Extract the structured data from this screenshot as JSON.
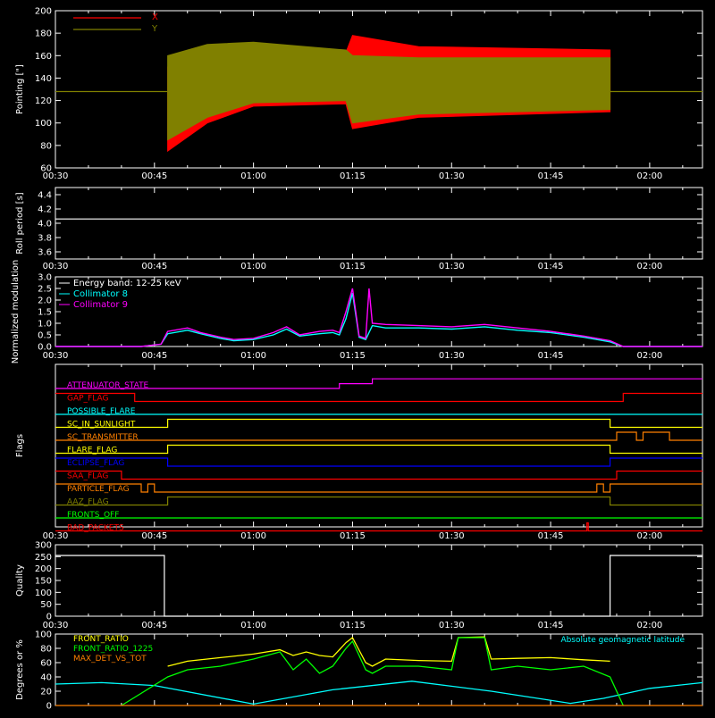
{
  "colors": {
    "background": "#000000",
    "axes": "#ffffff",
    "x_pointing": "#ff0000",
    "y_pointing": "#808000",
    "cyan": "#00ffff",
    "magenta": "#ff00ff",
    "yellow": "#ffff00",
    "green": "#00ff00",
    "orange": "#ff8000",
    "blue": "#0000ff",
    "red": "#ff0000"
  },
  "shared_x_ticks": [
    "00:30",
    "00:45",
    "01:00",
    "01:15",
    "01:30",
    "01:45",
    "02:00"
  ],
  "chart_data": [
    {
      "type": "line",
      "panel": "pointing",
      "ylabel": "Pointing [\"]",
      "ylim": [
        60,
        200
      ],
      "yticks": [
        60,
        80,
        100,
        120,
        140,
        160,
        180,
        200
      ],
      "xlim_minutes": [
        30,
        128
      ],
      "legend": {
        "placement": "top-left",
        "entries": [
          "X",
          "Y"
        ]
      },
      "series": [
        {
          "name": "X",
          "color": "#ff0000",
          "segments": [
            {
              "x": [
                47,
                53,
                60,
                74,
                75,
                85,
                114
              ],
              "upper": [
                150,
                168,
                170,
                163,
                178,
                168,
                165
              ],
              "lower": [
                75,
                100,
                115,
                117,
                95,
                105,
                110
              ]
            }
          ]
        },
        {
          "name": "Y",
          "color": "#808000",
          "flat_value": 128,
          "segments": [
            {
              "x": [
                47,
                53,
                60,
                74,
                75,
                85,
                114
              ],
              "upper": [
                160,
                170,
                172,
                165,
                160,
                158,
                158
              ],
              "lower": [
                85,
                105,
                118,
                120,
                100,
                108,
                112
              ]
            }
          ]
        }
      ]
    },
    {
      "type": "line",
      "panel": "roll_period",
      "ylabel": "Roll period [s]",
      "ylim": [
        3.5,
        4.5
      ],
      "yticks": [
        3.6,
        3.8,
        4.0,
        4.2,
        4.4
      ],
      "series": [
        {
          "color": "#ffffff",
          "x": [
            30,
            128
          ],
          "y": [
            4.06,
            4.06
          ]
        }
      ]
    },
    {
      "type": "line",
      "panel": "modulation",
      "ylabel": "Normalized modulation",
      "ylim": [
        0,
        3.0
      ],
      "yticks": [
        0.0,
        0.5,
        1.0,
        1.5,
        2.0,
        2.5,
        3.0
      ],
      "legend_title": "Energy band: 12-25 keV",
      "series": [
        {
          "name": "Collimator 8",
          "color": "#00ffff",
          "x": [
            30,
            43,
            46,
            47,
            50,
            52,
            55,
            57,
            60,
            63,
            65,
            67,
            70,
            72,
            73,
            74,
            75,
            76,
            77,
            78,
            80,
            85,
            90,
            95,
            100,
            105,
            110,
            114,
            116,
            128
          ],
          "y": [
            0,
            0,
            0.1,
            0.55,
            0.7,
            0.55,
            0.35,
            0.25,
            0.3,
            0.5,
            0.75,
            0.45,
            0.55,
            0.6,
            0.5,
            1.2,
            2.3,
            0.4,
            0.3,
            0.9,
            0.8,
            0.8,
            0.75,
            0.85,
            0.7,
            0.6,
            0.4,
            0.2,
            0,
            0
          ]
        },
        {
          "name": "Collimator 9",
          "color": "#ff00ff",
          "x": [
            30,
            43,
            46,
            47,
            50,
            52,
            55,
            57,
            60,
            63,
            65,
            67,
            70,
            72,
            73,
            74,
            75,
            76,
            77,
            77.5,
            78,
            80,
            85,
            90,
            95,
            100,
            105,
            110,
            114,
            116,
            128
          ],
          "y": [
            0,
            0,
            0.1,
            0.65,
            0.8,
            0.6,
            0.4,
            0.3,
            0.35,
            0.6,
            0.85,
            0.5,
            0.65,
            0.7,
            0.6,
            1.5,
            2.5,
            0.45,
            0.35,
            2.5,
            1.0,
            0.95,
            0.9,
            0.85,
            0.95,
            0.8,
            0.65,
            0.45,
            0.25,
            0,
            0
          ]
        }
      ]
    },
    {
      "type": "line",
      "panel": "flags",
      "ylabel": "Flags",
      "series": [
        {
          "name": "ATTENUATOR_STATE",
          "color": "#ff00ff",
          "x": [
            30,
            73,
            73,
            78,
            78,
            128
          ],
          "y": [
            0,
            0,
            1,
            1,
            2,
            2
          ]
        },
        {
          "name": "GAP_FLAG",
          "color": "#ff0000",
          "x": [
            30,
            42,
            42,
            116,
            116,
            128
          ],
          "y": [
            1,
            1,
            0,
            0,
            1,
            1
          ]
        },
        {
          "name": "POSSIBLE_FLARE",
          "color": "#00ffff",
          "x": [
            30,
            128
          ],
          "y": [
            0,
            0
          ]
        },
        {
          "name": "SC_IN_SUNLIGHT",
          "color": "#ffff00",
          "x": [
            30,
            47,
            47,
            114,
            114,
            128
          ],
          "y": [
            0,
            0,
            1,
            1,
            0,
            0
          ]
        },
        {
          "name": "SC_TRANSMITTER",
          "color": "#ff8000",
          "x": [
            30,
            115,
            115,
            118,
            118,
            119,
            119,
            123,
            123,
            128
          ],
          "y": [
            0,
            0,
            1,
            1,
            0,
            0,
            1,
            1,
            0,
            0
          ]
        },
        {
          "name": "FLARE_FLAG",
          "color": "#ffff00",
          "x": [
            30,
            47,
            47,
            114,
            114,
            128
          ],
          "y": [
            0,
            0,
            1,
            1,
            0,
            0
          ]
        },
        {
          "name": "ECLIPSE_FLAG",
          "color": "#0000ff",
          "x": [
            30,
            47,
            47,
            114,
            114,
            128
          ],
          "y": [
            1,
            1,
            0,
            0,
            1,
            1
          ]
        },
        {
          "name": "SAA_FLAG",
          "color": "#ff0000",
          "x": [
            30,
            40,
            40,
            115,
            115,
            128
          ],
          "y": [
            1,
            1,
            0,
            0,
            1,
            1
          ]
        },
        {
          "name": "PARTICLE_FLAG",
          "color": "#ff8000",
          "x": [
            30,
            43,
            43,
            44,
            44,
            45,
            45,
            47,
            47,
            112,
            112,
            113,
            113,
            114,
            114,
            128
          ],
          "y": [
            1,
            1,
            0,
            0,
            1,
            1,
            0,
            0,
            0,
            0,
            1,
            1,
            0,
            0,
            1,
            1
          ]
        },
        {
          "name": "AAZ_FLAG",
          "color": "#808000",
          "x": [
            30,
            47,
            47,
            114,
            114,
            128
          ],
          "y": [
            0,
            0,
            1,
            1,
            0,
            0
          ]
        },
        {
          "name": "FRONTS_OFF",
          "color": "#00ff00",
          "x": [
            30,
            128
          ],
          "y": [
            0,
            0
          ]
        },
        {
          "name": "BAD_PACKETS",
          "color": "#ff0000",
          "x": [
            30,
            110.5,
            110.5,
            110.7,
            110.7,
            128
          ],
          "y": [
            0,
            0,
            1,
            1,
            0,
            0
          ]
        }
      ]
    },
    {
      "type": "line",
      "panel": "quality",
      "ylabel": "Quality",
      "ylim": [
        0,
        300
      ],
      "yticks": [
        0,
        50,
        100,
        150,
        200,
        250,
        300
      ],
      "series": [
        {
          "color": "#ffffff",
          "x": [
            30,
            46.5,
            46.5,
            114,
            114,
            128
          ],
          "y": [
            255,
            255,
            0,
            0,
            255,
            255
          ]
        }
      ]
    },
    {
      "type": "line",
      "panel": "front_ratio",
      "ylabel": "Degrees or %",
      "ylim": [
        0,
        100
      ],
      "yticks": [
        0,
        20,
        40,
        60,
        80,
        100
      ],
      "annotation": "Absolute geomagnetic latitude",
      "series": [
        {
          "name": "FRONT_RATIO",
          "color": "#ffff00",
          "x": [
            47,
            50,
            55,
            60,
            64,
            66,
            68,
            70,
            72,
            74,
            75,
            77,
            78,
            80,
            85,
            90,
            91,
            95,
            96,
            100,
            105,
            110,
            114
          ],
          "y": [
            55,
            62,
            67,
            72,
            78,
            70,
            75,
            70,
            68,
            88,
            95,
            60,
            55,
            65,
            63,
            62,
            95,
            96,
            65,
            66,
            67,
            64,
            62
          ]
        },
        {
          "name": "FRONT_RATIO_1225",
          "color": "#00ff00",
          "x": [
            40,
            47,
            50,
            55,
            60,
            64,
            66,
            68,
            70,
            72,
            74,
            75,
            77,
            78,
            80,
            85,
            90,
            91,
            95,
            96,
            100,
            105,
            110,
            114,
            116
          ],
          "y": [
            0,
            40,
            50,
            55,
            65,
            75,
            50,
            65,
            45,
            55,
            80,
            90,
            50,
            45,
            55,
            55,
            50,
            95,
            95,
            50,
            55,
            50,
            55,
            40,
            0
          ]
        },
        {
          "name": "MAX_DET_VS_TOT",
          "color": "#ff8000",
          "x": [
            30,
            128
          ],
          "y": [
            0,
            0
          ]
        },
        {
          "color": "#00ffff",
          "x": [
            30,
            37,
            45,
            60,
            72,
            84,
            96,
            108,
            113,
            120,
            128
          ],
          "y": [
            30,
            32,
            28,
            2,
            22,
            34,
            20,
            3,
            10,
            24,
            32
          ]
        }
      ]
    }
  ]
}
